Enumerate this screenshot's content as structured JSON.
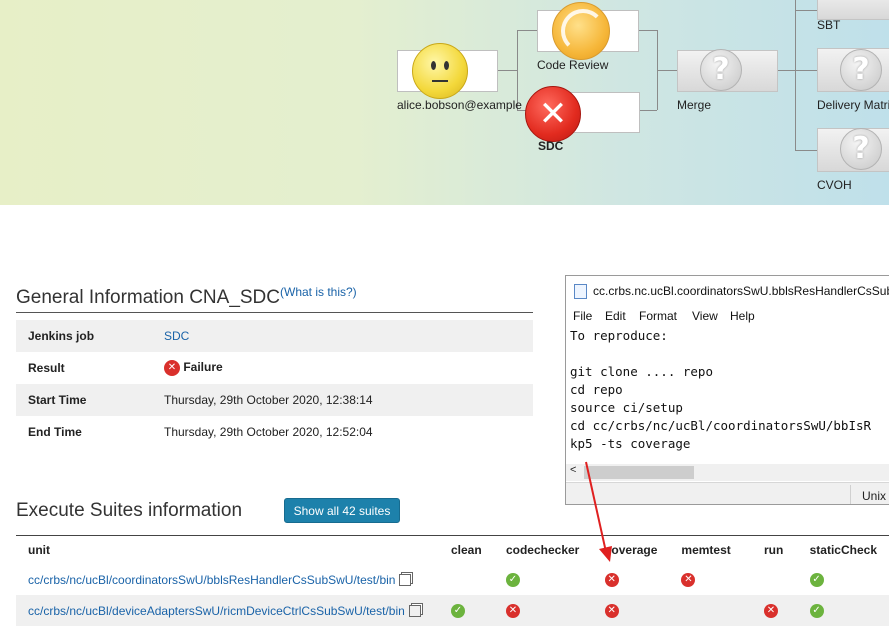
{
  "pipeline": {
    "nodes": {
      "user": "alice.bobson@example",
      "code_review": "Code Review",
      "sdc": "SDC",
      "merge": "Merge",
      "sbt": "SBT",
      "delivery": "Delivery Matri",
      "cvoh": "CVOH"
    }
  },
  "general": {
    "title": "General Information CNA_SDC",
    "help_link": "(What is this?)",
    "rows": [
      {
        "key": "Jenkins job",
        "value": "SDC"
      },
      {
        "key": "Result",
        "value": "Failure"
      },
      {
        "key": "Start Time",
        "value": "Thursday, 29th October 2020, 12:38:14"
      },
      {
        "key": "End Time",
        "value": "Thursday, 29th October 2020, 12:52:04"
      }
    ]
  },
  "suites": {
    "title": "Execute Suites information",
    "show_all_button": "Show all 42 suites",
    "columns": [
      "unit",
      "clean",
      "codechecker",
      "coverage",
      "memtest",
      "run",
      "staticCheck"
    ],
    "rows": [
      {
        "unit": "cc/crbs/nc/ucBl/coordinatorsSwU/bblsResHandlerCsSubSwU/test/bin",
        "status": [
          "",
          "ok",
          "fail",
          "fail",
          "",
          "ok"
        ]
      },
      {
        "unit": "cc/crbs/nc/ucBl/deviceAdaptersSwU/ricmDeviceCtrlCsSubSwU/test/bin",
        "status": [
          "ok",
          "fail",
          "fail",
          "",
          "fail",
          "ok"
        ]
      }
    ]
  },
  "notepad": {
    "title": "cc.crbs.nc.ucBl.coordinatorsSwU.bblsResHandlerCsSubS",
    "menu": [
      "File",
      "Edit",
      "Format",
      "View",
      "Help"
    ],
    "text_lines": [
      "To reproduce:",
      "",
      "git clone .... repo",
      "cd repo",
      "source ci/setup",
      "cd cc/crbs/nc/ucBl/coordinatorsSwU/bbIsR",
      "kp5 -ts coverage"
    ],
    "status_encoding": "Unix"
  },
  "colors": {
    "fail": "#d9302c",
    "ok": "#6cb33e",
    "link": "#1a63a8",
    "button": "#1d81ab",
    "annotation_arrow": "#e02020"
  }
}
